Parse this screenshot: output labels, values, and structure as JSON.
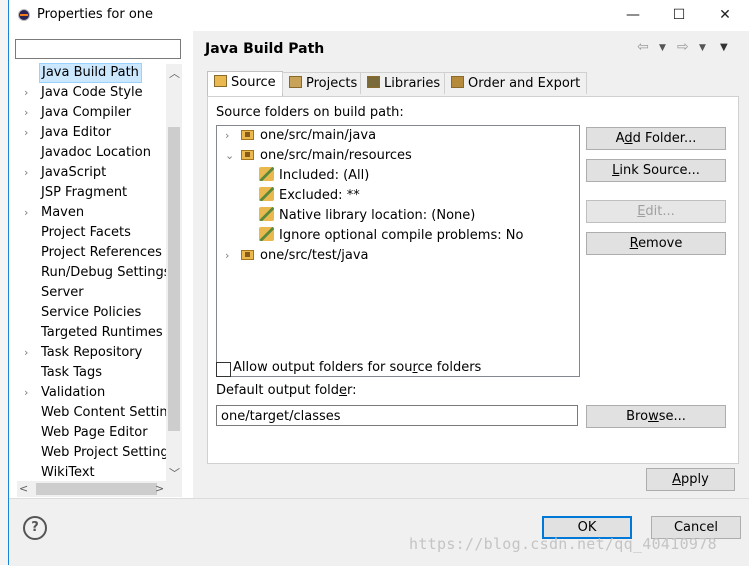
{
  "window": {
    "title": "Properties for one",
    "minimize": "—",
    "maximize": "☐",
    "close": "✕"
  },
  "left": {
    "filter_value": "",
    "items": [
      {
        "label": "Java Build Path",
        "expandable": false,
        "selected": true
      },
      {
        "label": "Java Code Style",
        "expandable": true
      },
      {
        "label": "Java Compiler",
        "expandable": true
      },
      {
        "label": "Java Editor",
        "expandable": true
      },
      {
        "label": "Javadoc Location",
        "expandable": false
      },
      {
        "label": "JavaScript",
        "expandable": true
      },
      {
        "label": "JSP Fragment",
        "expandable": false
      },
      {
        "label": "Maven",
        "expandable": true
      },
      {
        "label": "Project Facets",
        "expandable": false
      },
      {
        "label": "Project References",
        "expandable": false
      },
      {
        "label": "Run/Debug Settings",
        "expandable": false
      },
      {
        "label": "Server",
        "expandable": false
      },
      {
        "label": "Service Policies",
        "expandable": false
      },
      {
        "label": "Targeted Runtimes",
        "expandable": false
      },
      {
        "label": "Task Repository",
        "expandable": true
      },
      {
        "label": "Task Tags",
        "expandable": false
      },
      {
        "label": "Validation",
        "expandable": true
      },
      {
        "label": "Web Content Settings",
        "expandable": false
      },
      {
        "label": "Web Page Editor",
        "expandable": false
      },
      {
        "label": "Web Project Settings",
        "expandable": false
      },
      {
        "label": "WikiText",
        "expandable": false
      }
    ]
  },
  "page": {
    "title": "Java Build Path"
  },
  "tabs": [
    {
      "label": "Source",
      "active": true,
      "icon": "source-folder-icon"
    },
    {
      "label": "Projects",
      "active": false,
      "icon": "projects-icon"
    },
    {
      "label": "Libraries",
      "active": false,
      "icon": "libraries-icon"
    },
    {
      "label": "Order and Export",
      "active": false,
      "icon": "order-export-icon"
    }
  ],
  "source": {
    "list_label": "Source folders on build path:",
    "folders": [
      {
        "path": "one/src/main/java",
        "expanded": false
      },
      {
        "path": "one/src/main/resources",
        "expanded": true,
        "children": [
          {
            "text": "Included: (All)",
            "icon": "inclusion-filter-icon"
          },
          {
            "text": "Excluded: **",
            "icon": "exclusion-filter-icon"
          },
          {
            "text": "Native library location: (None)",
            "icon": "native-library-icon"
          },
          {
            "text": "Ignore optional compile problems: No",
            "icon": "ignore-problems-icon"
          }
        ]
      },
      {
        "path": "one/src/test/java",
        "expanded": false
      }
    ],
    "buttons": {
      "add_folder": {
        "pre": "A",
        "key": "d",
        "post": "d Folder..."
      },
      "link_source": {
        "pre": "",
        "key": "L",
        "post": "ink Source..."
      },
      "edit": {
        "pre": "",
        "key": "E",
        "post": "dit..."
      },
      "remove": {
        "pre": "",
        "key": "R",
        "post": "emove"
      }
    },
    "allow_output_label": {
      "pre": "Allow output folders for sou",
      "key": "r",
      "post": "ce folders"
    },
    "allow_output_checked": false,
    "default_output_label": {
      "pre": "Default output fold",
      "key": "e",
      "post": "r:"
    },
    "default_output_value": "one/target/classes",
    "browse": {
      "pre": "Bro",
      "key": "w",
      "post": "se..."
    }
  },
  "apply": {
    "pre": "",
    "key": "A",
    "post": "pply"
  },
  "ok_label": "OK",
  "cancel_label": "Cancel",
  "help_glyph": "?",
  "watermark": "https://blog.csdn.net/qq_40410978",
  "colors": {
    "accent": "#0078d7",
    "selection": "#cce8ff",
    "folder": "#e9b84f"
  }
}
